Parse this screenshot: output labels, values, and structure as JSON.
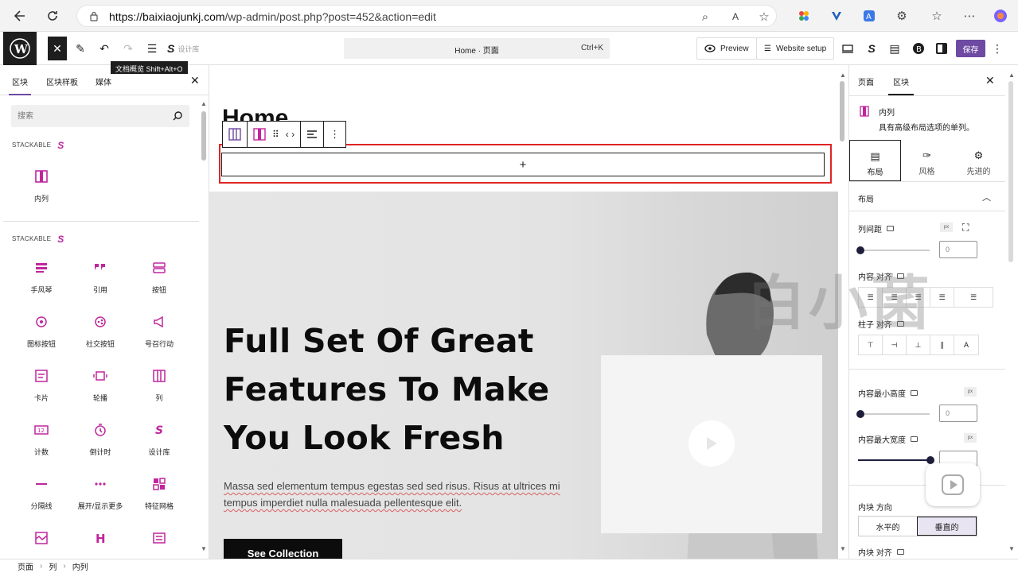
{
  "browser": {
    "url_host": "https://baixiaojunkj.com",
    "url_path": "/wp-admin/post.php?post=452&action=edit"
  },
  "toolbar": {
    "doc_title": "Home · 页面",
    "shortcut": "Ctrl+K",
    "tooltip": "文档概览  Shift+Alt+O",
    "preview_label": "Preview",
    "website_setup_label": "Website setup",
    "save_label": "保存",
    "design_lib_partial": "设计库"
  },
  "left_panel": {
    "tabs": [
      "区块",
      "区块样板",
      "媒体"
    ],
    "search_placeholder": "搜索",
    "category1": "STACKABLE",
    "category1_items": [
      "内列"
    ],
    "category2": "STACKABLE",
    "category2_items": [
      "手风琴",
      "引用",
      "按钮",
      "图标按钮",
      "社交按钮",
      "号召行动",
      "卡片",
      "轮播",
      "列",
      "计数",
      "倒计时",
      "设计库",
      "分隔线",
      "展开/显示更多",
      "特征网格",
      "",
      "",
      ""
    ]
  },
  "canvas": {
    "page_title": "Home",
    "hero_heading": "Full Set Of Great Features To Make You Look Fresh",
    "hero_paragraph": "Massa sed elementum tempus egestas sed sed risus. Risus at ultrices mi tempus imperdiet nulla malesuada pellentesque elit.",
    "hero_button": "See Collection"
  },
  "watermark": "白小菌",
  "right_panel": {
    "tabs": [
      "页面",
      "区块"
    ],
    "block_name": "内列",
    "block_desc": "具有高级布局选项的单列。",
    "sub_tabs": [
      "布局",
      "风格",
      "先进的"
    ],
    "section_title": "布局",
    "column_gap_label": "列间距",
    "column_gap_value": "0",
    "content_align_label": "内容 对齐",
    "column_align_label": "柱子 对齐",
    "min_height_label": "内容最小高度",
    "min_height_value": "0",
    "max_width_label": "内容最大宽度",
    "inner_direction_label": "内块 方向",
    "dir_horizontal": "水平的",
    "dir_vertical": "垂直的",
    "inner_align_label": "内块 对齐",
    "px": "px"
  },
  "breadcrumb": [
    "页面",
    "列",
    "内列"
  ],
  "colors": {
    "accent": "#6e4aa3",
    "stackable": "#c0269e",
    "highlight": "#e02424"
  }
}
